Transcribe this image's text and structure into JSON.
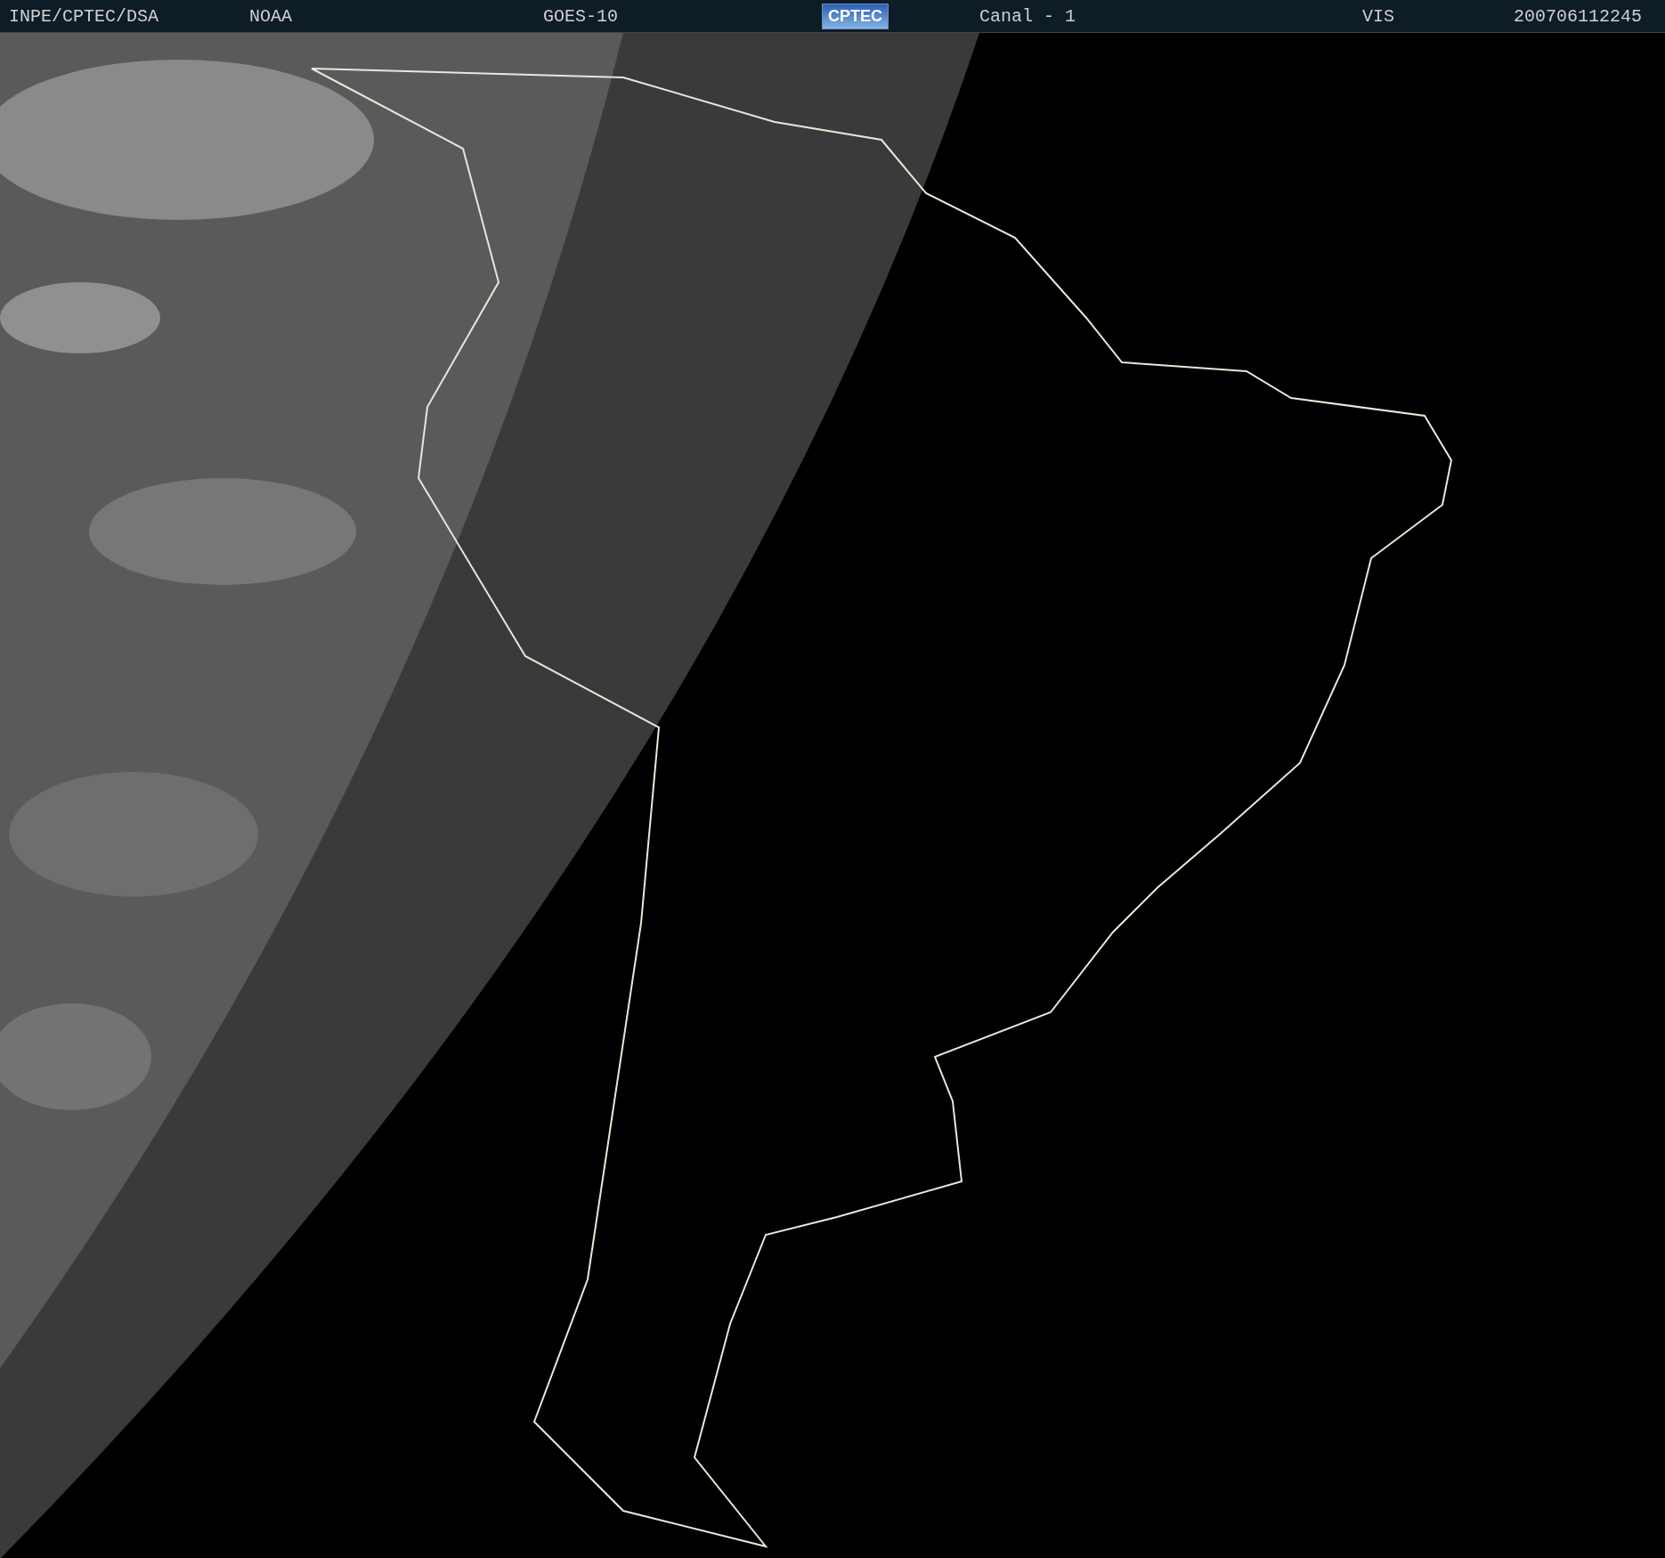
{
  "header": {
    "items": [
      {
        "kind": "text",
        "text": "INPE/CPTEC/DSA"
      },
      {
        "kind": "text",
        "text": "NOAA"
      },
      {
        "kind": "text",
        "text": "GOES-10"
      },
      {
        "kind": "logo",
        "text": "CPTEC"
      },
      {
        "kind": "text",
        "text": "Canal - 1"
      },
      {
        "kind": "text",
        "text": "VIS"
      },
      {
        "kind": "text",
        "text": "200706112245"
      }
    ]
  }
}
